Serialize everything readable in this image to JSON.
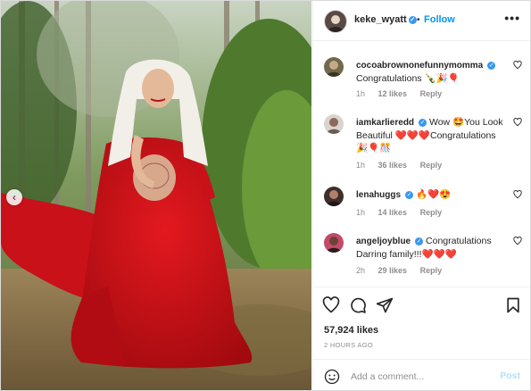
{
  "post": {
    "author": "keke_wyatt",
    "follow_label": "Follow",
    "separator": "•",
    "more_label": "•••",
    "carousel_prev": "‹",
    "likes": "57,924 likes",
    "timestamp": "2 HOURS AGO"
  },
  "comments": [
    {
      "username": "cocoabrownonefunnymomma",
      "verified": true,
      "text": "Congratulations 🍾🎉🎈",
      "age": "1h",
      "likes": "12 likes",
      "reply": "Reply"
    },
    {
      "username": "iamkarlieredd",
      "verified": true,
      "text": "Wow 🤩You Look Beautiful ❤️❤️❤️Congratulations 🎉🎈🎊",
      "age": "1h",
      "likes": "36 likes",
      "reply": "Reply"
    },
    {
      "username": "lenahuggs",
      "verified": true,
      "text": "🔥❤️😍",
      "age": "1h",
      "likes": "14 likes",
      "reply": "Reply"
    },
    {
      "username": "angeljoyblue",
      "verified": true,
      "text": "Congratulations Darring family!!!❤️❤️❤️",
      "age": "2h",
      "likes": "29 likes",
      "reply": "Reply"
    }
  ],
  "composer": {
    "placeholder": "Add a comment...",
    "post_label": "Post"
  },
  "colors": {
    "accent": "#0095f6",
    "verified": "#3897f0",
    "muted": "#8e8e8e",
    "post_disabled": "#b2dffc",
    "dress": "#d10f15"
  }
}
